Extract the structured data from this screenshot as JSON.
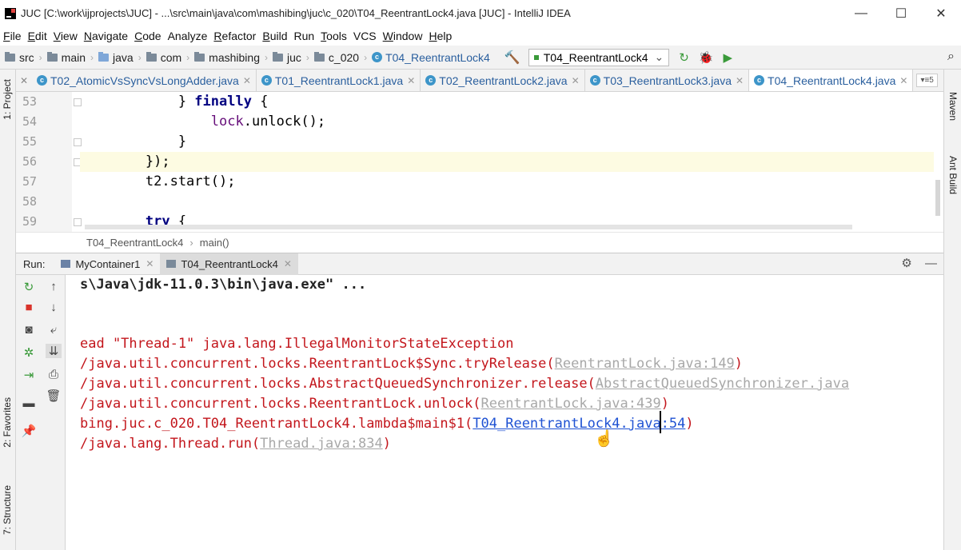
{
  "window": {
    "title": "JUC [C:\\work\\ijprojects\\JUC] - ...\\src\\main\\java\\com\\mashibing\\juc\\c_020\\T04_ReentrantLock4.java [JUC] - IntelliJ IDEA",
    "minimize": "—",
    "maximize": "☐",
    "close": "✕"
  },
  "menu": [
    {
      "u": "F",
      "rest": "ile"
    },
    {
      "u": "E",
      "rest": "dit"
    },
    {
      "u": "V",
      "rest": "iew"
    },
    {
      "u": "N",
      "rest": "avigate"
    },
    {
      "u": "C",
      "rest": "ode"
    },
    {
      "u": "",
      "rest": "Analyze"
    },
    {
      "u": "R",
      "rest": "efactor"
    },
    {
      "u": "B",
      "rest": "uild"
    },
    {
      "u": "",
      "rest": "Run"
    },
    {
      "u": "T",
      "rest": "ools"
    },
    {
      "u": "",
      "rest": "VCS"
    },
    {
      "u": "W",
      "rest": "indow"
    },
    {
      "u": "H",
      "rest": "elp"
    }
  ],
  "navbar": {
    "crumbs": [
      "src",
      "main",
      "java",
      "com",
      "mashibing",
      "juc",
      "c_020",
      "T04_ReentrantLock4"
    ],
    "run_config": "T04_ReentrantLock4",
    "icons": [
      "hammer-icon",
      "rerun-icon",
      "debug-icon",
      "coverage-icon",
      "search-icon"
    ]
  },
  "left_strip": {
    "project": "1: Project",
    "favorites": "2: Favorites",
    "structure": "7: Structure"
  },
  "right_strip": {
    "maven": "Maven",
    "ant": "Ant Build"
  },
  "tabs": [
    {
      "label": "T02_AtomicVsSyncVsLongAdder.java",
      "active": false
    },
    {
      "label": "T01_ReentrantLock1.java",
      "active": false
    },
    {
      "label": "T02_ReentrantLock2.java",
      "active": false
    },
    {
      "label": "T03_ReentrantLock3.java",
      "active": false
    },
    {
      "label": "T04_ReentrantLock4.java",
      "active": true
    }
  ],
  "tabs_more": "▾≡5",
  "editor": {
    "lines": [
      {
        "num": "53",
        "text": ""
      },
      {
        "num": "54",
        "text": ""
      },
      {
        "num": "55",
        "text": ""
      },
      {
        "num": "56",
        "text": ""
      },
      {
        "num": "57",
        "text": ""
      },
      {
        "num": "58",
        "text": ""
      },
      {
        "num": "59",
        "text": ""
      }
    ],
    "code": {
      "l53_pre": "            } ",
      "l53_kw": "finally",
      "l53_post": " {",
      "l54_pre": "                ",
      "l54_fld": "lock",
      "l54_post": ".unlock();",
      "l55": "            }",
      "l56": "        });",
      "l57": "        t2.start();",
      "l58": "",
      "l59_pre": "        ",
      "l59_kw": "try",
      "l59_post": " {"
    }
  },
  "breadcrumb": {
    "cls": "T04_ReentrantLock4",
    "sep": "›",
    "method": "main()"
  },
  "run": {
    "label": "Run:",
    "tabs": [
      {
        "label": "MyContainer1"
      },
      {
        "label": "T04_ReentrantLock4"
      }
    ],
    "gear": "⚙",
    "minimize": "—"
  },
  "console": {
    "cmd": "s\\Java\\jdk-11.0.3\\bin\\java.exe\" ...",
    "e1": "ead \"Thread-1\" java.lang.IllegalMonitorStateException",
    "e2_pre": "/java.util.concurrent.locks.ReentrantLock$Sync.tryRelease(",
    "e2_src": "ReentrantLock.java:149",
    "e2_post": ")",
    "e3_pre": "/java.util.concurrent.locks.AbstractQueuedSynchronizer.release(",
    "e3_src": "AbstractQueuedSynchronizer.java",
    "e4_pre": "/java.util.concurrent.locks.ReentrantLock.unlock(",
    "e4_src": "ReentrantLock.java:439",
    "e4_post": ")",
    "e5_pre": "bing.juc.c_020.T04_ReentrantLock4.lambda$main$1(",
    "e5_link": "T04_ReentrantLock4.java:54",
    "e5_post": ")",
    "e6_pre": "/java.lang.Thread.run(",
    "e6_src": "Thread.java:834",
    "e6_post": ")"
  }
}
